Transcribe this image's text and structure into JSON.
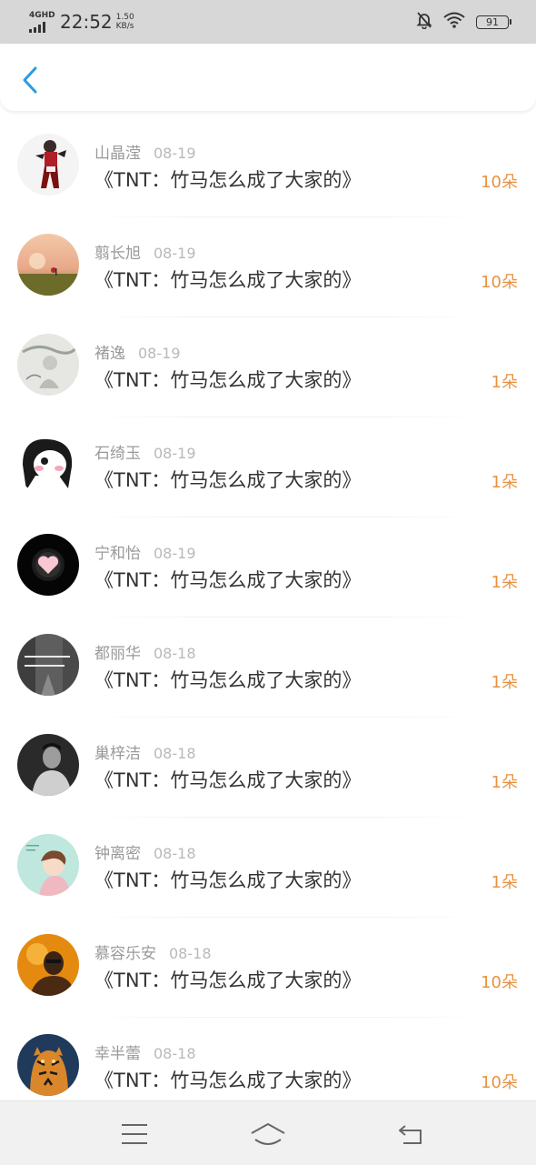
{
  "status_bar": {
    "network_type": "4GHD",
    "time": "22:52",
    "speed_value": "1.50",
    "speed_unit": "KB/s",
    "battery_level": "91",
    "icons": [
      "signal-bars-icon",
      "mute-bell-icon",
      "wifi-icon",
      "battery-icon"
    ]
  },
  "header": {
    "back_icon": "chevron-left-icon",
    "accent_color": "#2a9be3"
  },
  "colors": {
    "name": "#9a9a9a",
    "date": "#b9b9b9",
    "title": "#333333",
    "count": "#e79242"
  },
  "records": [
    {
      "name": "山晶滢",
      "date": "08-19",
      "title": "《TNT：竹马怎么成了大家的》",
      "count": "10朵",
      "avatar": "avatar-fighter"
    },
    {
      "name": "翦长旭",
      "date": "08-19",
      "title": "《TNT：竹马怎么成了大家的》",
      "count": "10朵",
      "avatar": "avatar-sunset-field"
    },
    {
      "name": "褚逸",
      "date": "08-19",
      "title": "《TNT：竹马怎么成了大家的》",
      "count": "1朵",
      "avatar": "avatar-ink-painting"
    },
    {
      "name": "石绮玉",
      "date": "08-19",
      "title": "《TNT：竹马怎么成了大家的》",
      "count": "1朵",
      "avatar": "avatar-cartoon-girl"
    },
    {
      "name": "宁和怡",
      "date": "08-19",
      "title": "《TNT：竹马怎么成了大家的》",
      "count": "1朵",
      "avatar": "avatar-heart"
    },
    {
      "name": "都丽华",
      "date": "08-18",
      "title": "《TNT：竹马怎么成了大家的》",
      "count": "1朵",
      "avatar": "avatar-street-text"
    },
    {
      "name": "巢梓洁",
      "date": "08-18",
      "title": "《TNT：竹马怎么成了大家的》",
      "count": "1朵",
      "avatar": "avatar-man-portrait"
    },
    {
      "name": "钟离密",
      "date": "08-18",
      "title": "《TNT：竹马怎么成了大家的》",
      "count": "1朵",
      "avatar": "avatar-mint-girl"
    },
    {
      "name": "慕容乐安",
      "date": "08-18",
      "title": "《TNT：竹马怎么成了大家的》",
      "count": "10朵",
      "avatar": "avatar-orange-photo"
    },
    {
      "name": "幸半蕾",
      "date": "08-18",
      "title": "《TNT：竹马怎么成了大家的》",
      "count": "10朵",
      "avatar": "avatar-tiger"
    }
  ],
  "nav_bar": {
    "icons": [
      "menu-icon",
      "home-icon",
      "back-icon"
    ]
  }
}
